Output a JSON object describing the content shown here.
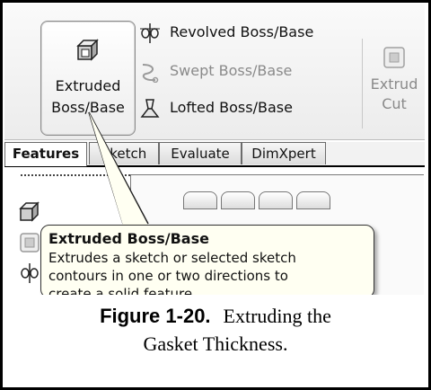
{
  "ribbon": {
    "extrude_button_label": [
      "Extruded",
      "Boss/Base"
    ],
    "commands": [
      {
        "label": "Revolved Boss/Base",
        "enabled": true,
        "icon": "revolve-icon"
      },
      {
        "label": "Swept Boss/Base",
        "enabled": false,
        "icon": "sweep-icon"
      },
      {
        "label": "Lofted Boss/Base",
        "enabled": true,
        "icon": "loft-icon"
      }
    ],
    "cut_label": [
      "Extrud",
      "Cut"
    ]
  },
  "tabs": [
    {
      "label": "Features",
      "active": true
    },
    {
      "label": "Sketch",
      "active": false
    },
    {
      "label": "Evaluate",
      "active": false
    },
    {
      "label": "DimXpert",
      "active": false
    }
  ],
  "tooltip": {
    "title": "Extruded Boss/Base",
    "lines": [
      "Extrudes a sketch or selected sketch",
      "contours in one or two directions to",
      "create a solid feature."
    ]
  },
  "caption": {
    "number": "Figure 1-20.",
    "line1": "Extruding the",
    "line2": "Gasket Thickness."
  },
  "colors": {
    "tooltip_bg": "#fffff2",
    "ribbon_bg": "#ececec"
  }
}
